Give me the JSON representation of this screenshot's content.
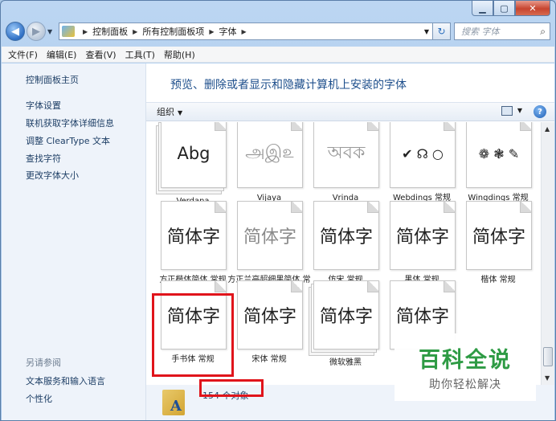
{
  "window": {
    "min_label": "▁",
    "max_label": "▢",
    "close_label": "✕"
  },
  "address": {
    "breadcrumbs": [
      "控制面板",
      "所有控制面板项",
      "字体"
    ],
    "search_placeholder": "搜索 字体"
  },
  "menu": [
    "文件(F)",
    "编辑(E)",
    "查看(V)",
    "工具(T)",
    "帮助(H)"
  ],
  "sidebar": {
    "home": "控制面板主页",
    "links": [
      "字体设置",
      "联机获取字体详细信息",
      "调整 ClearType 文本",
      "查找字符",
      "更改字体大小"
    ],
    "see_also_title": "另请参阅",
    "see_also": [
      "文本服务和输入语言",
      "个性化"
    ]
  },
  "main": {
    "heading": "预览、删除或者显示和隐藏计算机上安装的字体",
    "organize_label": "组织",
    "fonts_row1": [
      {
        "name": "Verdana",
        "sample": "Abg",
        "stacked": true
      },
      {
        "name": "Vijaya",
        "sample": "அஇ௨",
        "stacked": false
      },
      {
        "name": "Vrinda",
        "sample": "অবক",
        "stacked": false
      },
      {
        "name": "Webdings 常规",
        "sample": "✔ ☊ ○",
        "stacked": false
      },
      {
        "name": "Wingdings 常规",
        "sample": "❁ ❃ ✎",
        "stacked": false
      }
    ],
    "fonts_row2": [
      {
        "name": "方正楷体简体 常规",
        "sample": "简体字",
        "stacked": false
      },
      {
        "name": "方正兰亭超细黑简体 常规",
        "sample": "简体字",
        "stacked": false
      },
      {
        "name": "仿宋 常规",
        "sample": "简体字",
        "stacked": false
      },
      {
        "name": "黑体 常规",
        "sample": "简体字",
        "stacked": false
      },
      {
        "name": "楷体 常规",
        "sample": "简体字",
        "stacked": false
      }
    ],
    "fonts_row3": [
      {
        "name": "手书体 常规",
        "sample": "简体字",
        "stacked": false
      },
      {
        "name": "宋体 常规",
        "sample": "简体字",
        "stacked": false
      },
      {
        "name": "微软雅黑",
        "sample": "简体字",
        "stacked": true
      },
      {
        "name": "",
        "sample": "简体字",
        "stacked": false
      }
    ]
  },
  "status": {
    "count": "154 个对象"
  },
  "watermark": {
    "title": "百科全说",
    "subtitle": "助你轻松解决"
  },
  "colors": {
    "highlight": "#e0141b",
    "link": "#1e3f66",
    "heading": "#1e4f8c",
    "watermark_green": "#2e9b44"
  }
}
